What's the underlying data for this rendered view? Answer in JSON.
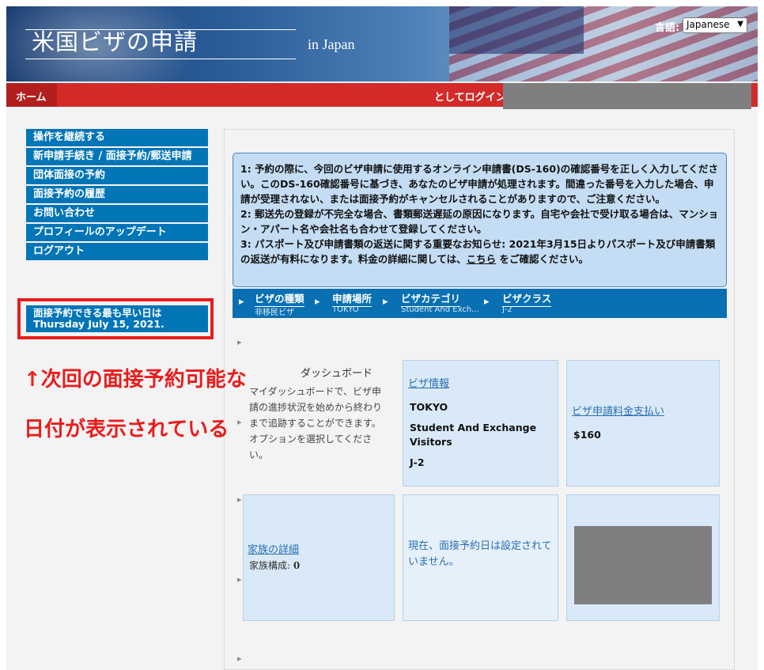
{
  "header": {
    "title": "米国ビザの申請",
    "subtitle": "in Japan",
    "language_label": "言語:",
    "language_selected": "Japanese"
  },
  "nav": {
    "home": "ホーム",
    "login_as": "としてログイン"
  },
  "menu": {
    "items": [
      "操作を継続する",
      "新申請手続き / 面接予約/郵送申請",
      "団体面接の予約",
      "面接予約の履歴",
      "お問い合わせ",
      "プロフィールのアップデート",
      "ログアウト"
    ]
  },
  "earliest": {
    "line1": "面接予約できる最も早い日は",
    "line2": "Thursday July 15, 2021."
  },
  "notice": {
    "p1": "1: 予約の際に、今回のビザ申請に使用するオンライン申請書(DS-160)の確認番号を正しく入力してください。このDS-160確認番号に基づき、あなたのビザ申請が処理されます。間違った番号を入力した場合、申請が受理されない、または面接予約がキャンセルされることがありますので、ご注意ください。",
    "p2": "2: 郵送先の登録が不完全な場合、書類郵送遅延の原因になります。自宅や会社で受け取る場合は、マンション・アパート名や会社名も合わせて登録してください。",
    "p3_before": "3: パスポート及び申請書類の返送に関する重要なお知らせ: 2021年3月15日よりパスポート及び申請書類の返送が有料になります。料金の詳細に関しては、",
    "p3_link": "こちら",
    "p3_after": "をご確認ください。"
  },
  "breadcrumbs": [
    {
      "label": "ビザの種類",
      "value": "非移民ビザ"
    },
    {
      "label": "申請場所",
      "value": "TOKYO"
    },
    {
      "label": "ビザカテゴリ",
      "value": "Student And Exch..."
    },
    {
      "label": "ビザクラス",
      "value": "J-2"
    }
  ],
  "dashboard": {
    "title": "ダッシュボード",
    "description": "マイダッシュボードで、ビザ申請の進捗状況を始めから終わりまで追跡することができます。オプションを選択してください。"
  },
  "cards": {
    "visa_info": {
      "link": "ビザ情報",
      "location": "TOKYO",
      "category": "Student And Exchange Visitors",
      "class": "J-2"
    },
    "fee": {
      "link": "ビザ申請料金支払い",
      "amount": "$160"
    },
    "family": {
      "link": "家族の詳細",
      "label": "家族構成:",
      "count": "0"
    },
    "appointment": {
      "text": "現在、面接予約日は設定されていません。"
    }
  },
  "annotation": {
    "line1": "↑次回の面接予約可能な",
    "line2": "日付が表示されている"
  },
  "colors": {
    "menu_blue": "#0275b6",
    "nav_red": "#d32a2a",
    "annotation_red": "#ea1c1c",
    "card_bg": "#d9e9f8"
  }
}
